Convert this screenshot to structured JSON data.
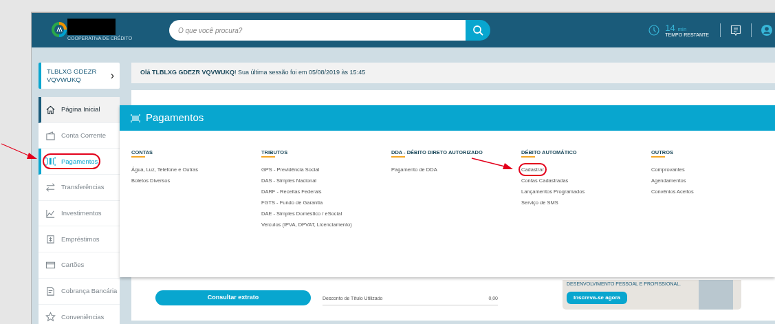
{
  "header": {
    "logo_subtitle": "COOPERATIVA DE CRÉDITO",
    "search": {
      "placeholder": "O que você procura?"
    },
    "session": {
      "time": "14",
      "unit": "min",
      "label": "TEMPO RESTANTE"
    }
  },
  "sidebar": {
    "user_name": "TLBLXG GDEZR VQVWUKQ",
    "user_arrow": "›",
    "items": [
      {
        "label": "Página Inicial",
        "highlighted": true,
        "selected": false,
        "circled": false
      },
      {
        "label": "Conta Corrente",
        "highlighted": false,
        "selected": false,
        "circled": false
      },
      {
        "label": "Pagamentos",
        "highlighted": false,
        "selected": true,
        "circled": true
      },
      {
        "label": "Transferências",
        "highlighted": false,
        "selected": false,
        "circled": false
      },
      {
        "label": "Investimentos",
        "highlighted": false,
        "selected": false,
        "circled": false
      },
      {
        "label": "Empréstimos",
        "highlighted": false,
        "selected": false,
        "circled": false
      },
      {
        "label": "Cartões",
        "highlighted": false,
        "selected": false,
        "circled": false
      },
      {
        "label": "Cobrança Bancária",
        "highlighted": false,
        "selected": false,
        "circled": false
      },
      {
        "label": "Conveniências",
        "highlighted": false,
        "selected": false,
        "circled": false
      }
    ]
  },
  "greeting": "**Olá TLBLXG GDEZR VQVWUKQ**! Sua última sessão foi em 05/08/2019 às 15:45",
  "mega_menu": {
    "title": "Pagamentos",
    "columns": [
      {
        "heading": "CONTAS",
        "links": [
          {
            "label": "Água, Luz, Telefone e Outras",
            "circled": false
          },
          {
            "label": "Boletos Diversos",
            "circled": false
          }
        ]
      },
      {
        "heading": "TRIBUTOS",
        "links": [
          {
            "label": "GPS - Previdência Social",
            "circled": false
          },
          {
            "label": "DAS - Simples Nacional",
            "circled": false
          },
          {
            "label": "DARF - Receitas Federais",
            "circled": false
          },
          {
            "label": "FGTS - Fundo de Garantia",
            "circled": false
          },
          {
            "label": "DAE - Simples Doméstico / eSocial",
            "circled": false
          },
          {
            "label": "Veículos (IPVA, DPVAT, Licenciamento)",
            "circled": false
          }
        ]
      },
      {
        "heading": "DDA - DÉBITO DIRETO AUTORIZADO",
        "links": [
          {
            "label": "Pagamento de DDA",
            "circled": false
          }
        ]
      },
      {
        "heading": "DÉBITO AUTOMÁTICO",
        "links": [
          {
            "label": "Cadastrar",
            "circled": true
          },
          {
            "label": "Contas Cadastradas",
            "circled": false
          },
          {
            "label": "Lançamentos Programados",
            "circled": false
          },
          {
            "label": "Serviço de SMS",
            "circled": false
          }
        ]
      },
      {
        "heading": "OUTROS",
        "links": [
          {
            "label": "Comprovantes",
            "circled": false
          },
          {
            "label": "Agendamentos",
            "circled": false
          },
          {
            "label": "Convênios Aceitos",
            "circled": false
          }
        ]
      }
    ]
  },
  "account": {
    "button": "Consultar extrato",
    "rows": [
      {
        "label": "Desconto de Título Utilizado",
        "value": "0,00"
      }
    ]
  },
  "banner": {
    "text": "DESENVOLVIMENTO PESSOAL E PROFISSIONAL.",
    "button": "Inscreva-se agora"
  }
}
